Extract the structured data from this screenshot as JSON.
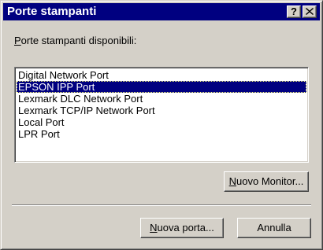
{
  "window": {
    "title": "Porte stampanti",
    "help_label": "?"
  },
  "ports_list": {
    "label_mnemonic": "P",
    "label_rest": "orte stampanti disponibili:",
    "items": [
      "Digital Network Port",
      "EPSON IPP Port",
      "Lexmark DLC Network Port",
      "Lexmark TCP/IP Network Port",
      "Local Port",
      "LPR Port"
    ],
    "selected_index": 1
  },
  "buttons": {
    "monitor_mnemonic": "N",
    "monitor_rest": "uovo Monitor...",
    "new_port_mnemonic": "N",
    "new_port_rest": "uova porta...",
    "cancel_label": "Annulla"
  }
}
